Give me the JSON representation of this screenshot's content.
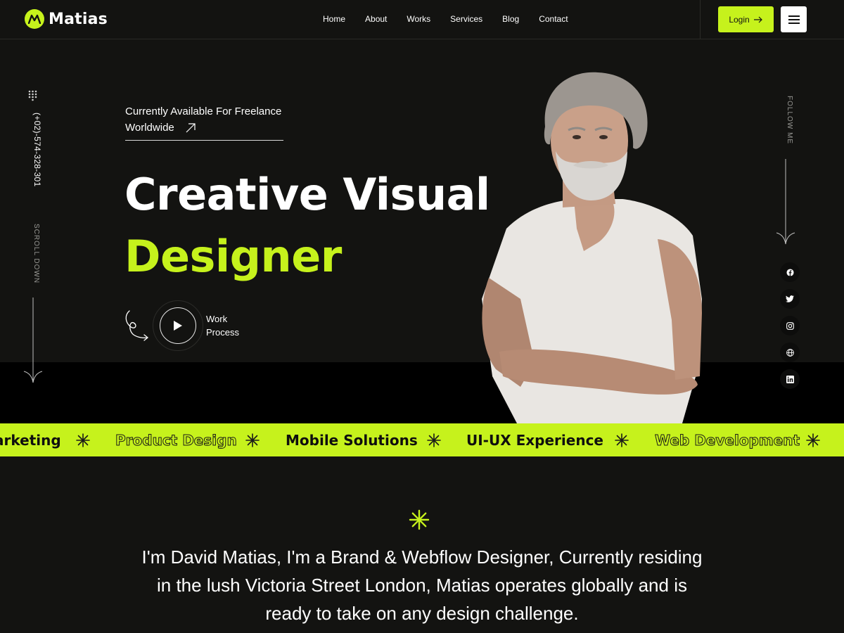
{
  "header": {
    "logo_text": "Matias",
    "nav": [
      "Home",
      "About",
      "Works",
      "Services",
      "Blog",
      "Contact"
    ],
    "login_label": "Login"
  },
  "hero": {
    "availability_line1": "Currently Available For Freelance",
    "availability_line2": "Worldwide",
    "title_line1": "Creative Visual",
    "title_line2": "Designer",
    "work_process_line1": "Work",
    "work_process_line2": "Process",
    "phone": "(+02)-574-328-301",
    "scroll_label": "SCROLL DOWN",
    "follow_label": "FOLLOW ME"
  },
  "social_icons": [
    "facebook-icon",
    "twitter-icon",
    "instagram-icon",
    "globe-icon",
    "linkedin-icon"
  ],
  "marquee": {
    "items": [
      {
        "label": "arketing",
        "style": "solid"
      },
      {
        "label": "Product Design",
        "style": "outline"
      },
      {
        "label": "Mobile Solutions",
        "style": "solid"
      },
      {
        "label": "UI-UX Experience",
        "style": "solid"
      },
      {
        "label": "Web Development",
        "style": "outline"
      }
    ]
  },
  "about": {
    "line1": "I'm David Matias, I'm a Brand & Webflow Designer, Currently residing",
    "line2": "in the lush Victoria Street London, Matias operates globally and is",
    "line3": "ready to take on any design challenge."
  },
  "colors": {
    "accent": "#c6f21c",
    "background": "#131311",
    "band": "#000000"
  }
}
